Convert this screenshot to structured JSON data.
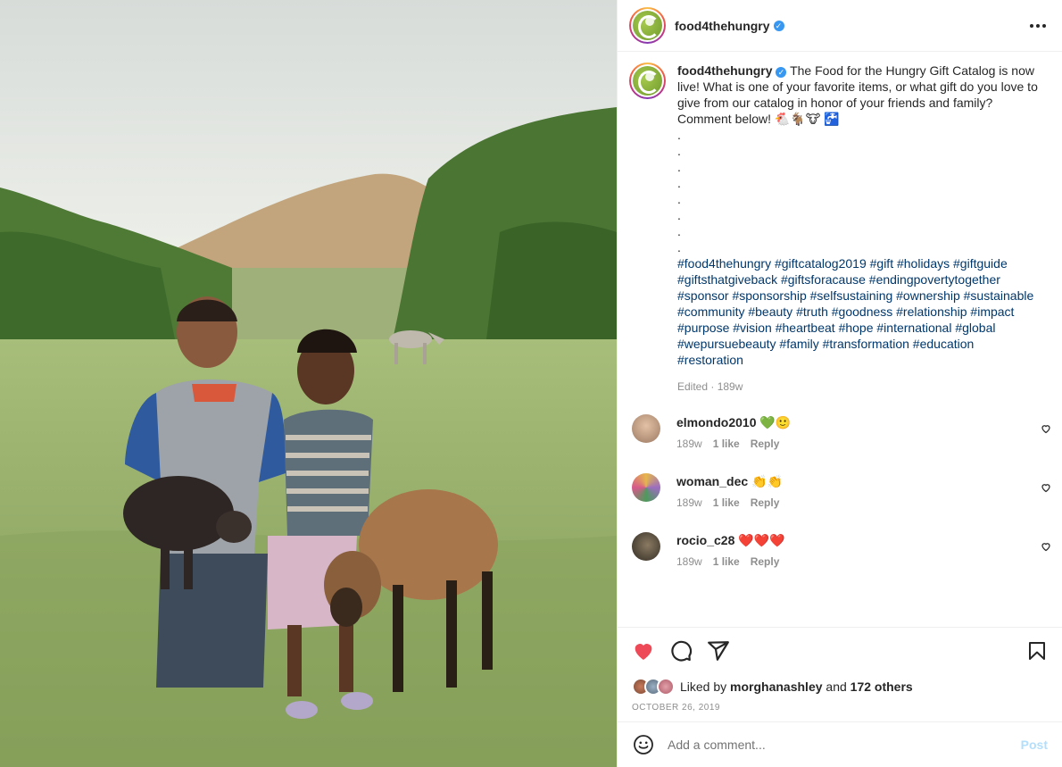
{
  "photo": {
    "alt_subject": "children-with-pig-and-sheep"
  },
  "header": {
    "username": "food4thehungry",
    "verified_icon": "verified-badge-icon",
    "more_icon": "more-options-icon"
  },
  "caption": {
    "username": "food4thehungry",
    "text": "The Food for the Hungry Gift Catalog is now live! What is one of your favorite items, or what gift do you love to give from our catalog in honor of your friends and family? Comment below! 🐔🐐🐮 🚰",
    "dots": [
      ".",
      ".",
      ".",
      ".",
      ".",
      ".",
      ".",
      "."
    ],
    "hashtags": "#food4thehungry #giftcatalog2019 #gift #holidays #giftguide #giftsthatgiveback #giftsforacause #endingpovertytogether #sponsor #sponsorship #selfsustaining #ownership #sustainable #community #beauty #truth #goodness #relationship #impact #purpose #vision #heartbeat #hope #international #global #wepursuebeauty #family #transformation #education #restoration",
    "meta": "Edited · 189w"
  },
  "comments": [
    {
      "username": "elmondo2010",
      "text": "💚🙂",
      "age": "189w",
      "likes": "1 like",
      "reply": "Reply",
      "avatar_color": "#c9a58a"
    },
    {
      "username": "woman_dec",
      "text": "👏👏",
      "age": "189w",
      "likes": "1 like",
      "reply": "Reply",
      "avatar_color": "#b9a4c8"
    },
    {
      "username": "rocio_c28",
      "text": "❤️❤️❤️",
      "age": "189w",
      "likes": "1 like",
      "reply": "Reply",
      "avatar_color": "#4a4236"
    }
  ],
  "actions": {
    "like_icon": "heart-filled-icon",
    "comment_icon": "comment-icon",
    "share_icon": "share-icon",
    "save_icon": "bookmark-icon",
    "liked_state": true,
    "like_color": "#ed4956"
  },
  "likes": {
    "prefix": "Liked by",
    "user": "morghanashley",
    "and": "and",
    "others": "172 others"
  },
  "post_date": "OCTOBER 26, 2019",
  "add_comment": {
    "placeholder": "Add a comment...",
    "post_label": "Post",
    "emoji_icon": "smiley-icon"
  }
}
